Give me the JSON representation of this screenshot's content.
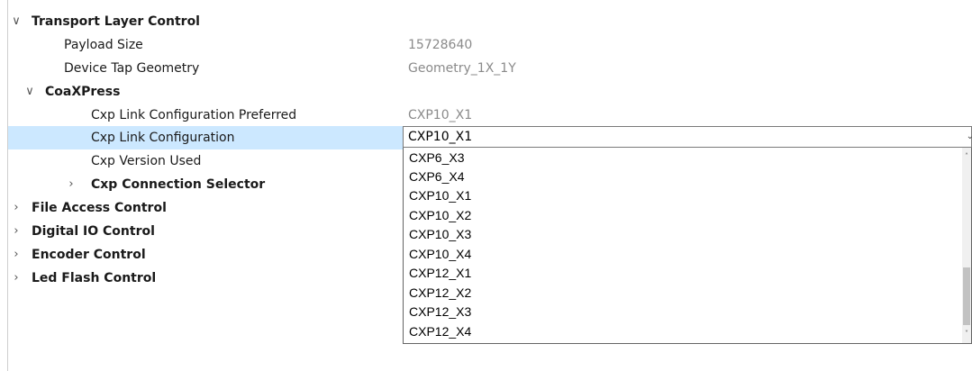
{
  "tree": {
    "transport": {
      "label": "Transport Layer Control",
      "expand_icon": "chevron-down"
    },
    "payload_size": {
      "label": "Payload Size",
      "value": "15728640"
    },
    "device_tap_geometry": {
      "label": "Device Tap Geometry",
      "value": "Geometry_1X_1Y"
    },
    "coaxpress": {
      "label": "CoaXPress",
      "expand_icon": "chevron-down"
    },
    "cxp_link_pref": {
      "label": "Cxp Link Configuration Preferred",
      "value": "CXP10_X1"
    },
    "cxp_link_config": {
      "label": "Cxp Link Configuration",
      "value": "CXP10_X1"
    },
    "cxp_version": {
      "label": "Cxp Version Used"
    },
    "cxp_conn_selector": {
      "label": "Cxp Connection Selector",
      "expand_icon": "chevron-right"
    },
    "file_access": {
      "label": "File Access Control",
      "expand_icon": "chevron-right"
    },
    "digital_io": {
      "label": "Digital IO Control",
      "expand_icon": "chevron-right"
    },
    "encoder": {
      "label": "Encoder Control",
      "expand_icon": "chevron-right"
    },
    "led_flash": {
      "label": "Led Flash Control",
      "expand_icon": "chevron-right"
    }
  },
  "dropdown": {
    "options": [
      "CXP6_X3",
      "CXP6_X4",
      "CXP10_X1",
      "CXP10_X2",
      "CXP10_X3",
      "CXP10_X4",
      "CXP12_X1",
      "CXP12_X2",
      "CXP12_X3",
      "CXP12_X4"
    ]
  },
  "colors": {
    "selection": "#cce8ff",
    "value_text": "#8a8a8a",
    "combo_border": "#7a7a7a"
  }
}
